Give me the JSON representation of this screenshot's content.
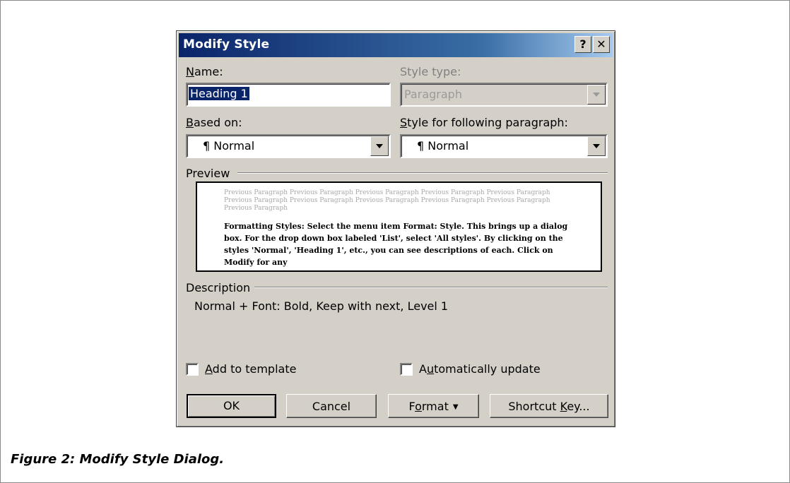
{
  "dialog": {
    "title": "Modify Style",
    "help_btn": "?",
    "close_btn": "✕"
  },
  "name": {
    "label": "Name:",
    "value": "Heading 1"
  },
  "style_type": {
    "label": "Style type:",
    "value": "Paragraph"
  },
  "based_on": {
    "label": "Based on:",
    "value": "¶ Normal"
  },
  "following": {
    "label": "Style for following paragraph:",
    "value": "¶ Normal"
  },
  "preview": {
    "label": "Preview",
    "previous_text": "Previous Paragraph Previous Paragraph Previous Paragraph Previous Paragraph Previous Paragraph Previous Paragraph Previous Paragraph Previous Paragraph Previous Paragraph Previous Paragraph Previous Paragraph",
    "sample_text": "Formatting Styles: Select the menu item Format: Style. This brings up a dialog box. For the drop down box labeled 'List', select 'All styles'. By clicking on the styles 'Normal', 'Heading 1', etc., you can see descriptions of each. Click on Modify for any"
  },
  "description": {
    "label": "Description",
    "text": "Normal + Font: Bold, Keep with next, Level 1"
  },
  "checkboxes": {
    "add_to_template": {
      "label": "Add to template",
      "checked": false
    },
    "auto_update": {
      "label": "Automatically update",
      "checked": false
    }
  },
  "buttons": {
    "ok": "OK",
    "cancel": "Cancel",
    "format": "Format",
    "shortcut": "Shortcut Key..."
  },
  "caption": "Figure 2: Modify Style Dialog."
}
